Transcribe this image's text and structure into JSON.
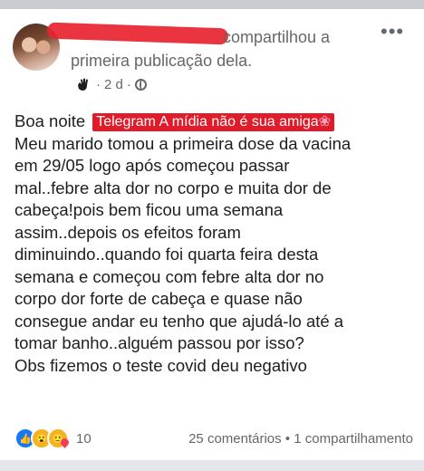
{
  "header": {
    "shared_line1": "compartilhou a",
    "shared_line2": "primeira publicação dela.",
    "time": "2 d",
    "separator": "·"
  },
  "post": {
    "greeting": "Boa noite",
    "banner": "Telegram A mídia não é sua amiga",
    "lines": [
      "Meu marido tomou a primeira dose da vacina",
      "em 29/05 logo após começou passar",
      "mal..febre alta dor no corpo e muita dor de",
      "cabeça!pois bem ficou uma semana",
      "assim..depois os efeitos foram",
      "diminuindo..quando foi quarta feira desta",
      "semana e começou com febre alta dor no",
      "corpo dor forte de cabeça e quase não",
      "consegue andar  eu tenho que ajudá-lo até a",
      "tomar banho..alguém passou por isso?",
      "Obs fizemos o teste covid deu negativo"
    ]
  },
  "footer": {
    "reaction_count": "10",
    "comments": "25 comentários",
    "dot": "•",
    "shares": "1 compartilhamento"
  },
  "icons": {
    "more": "more-horizontal-icon",
    "audience": "globe-icon",
    "hand": "waving-hand-icon",
    "reactions": [
      "like-icon",
      "wow-icon",
      "care-icon"
    ]
  },
  "colors": {
    "banner": "#e01b2a",
    "redaction": "#e8232f",
    "like": "#1877f2"
  }
}
